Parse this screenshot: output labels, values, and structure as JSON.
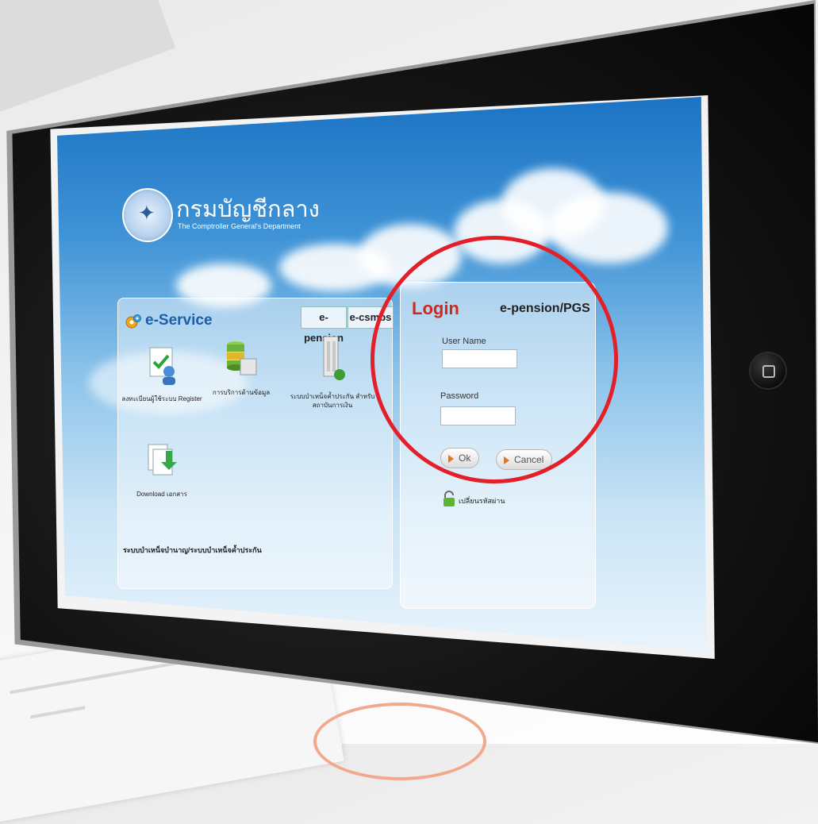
{
  "logo": {
    "thai_name": "กรมบัญชีกลาง",
    "english_name": "The Comptroller General's Department"
  },
  "eservice": {
    "title": "e-Service",
    "tabs": [
      "e-pension",
      "e-csmbs"
    ],
    "items": [
      {
        "label": "ลงทะเบียนผู้ใช้ระบบ Register",
        "icon": "register-icon"
      },
      {
        "label": "การบริการด้านข้อมูล",
        "icon": "database-icon"
      },
      {
        "label": "ระบบบำเหน็จค้ำประกัน สำหรับสถาบันการเงิน",
        "icon": "building-icon"
      },
      {
        "label": "Download เอกสาร",
        "icon": "download-icon"
      }
    ],
    "footer": "ระบบบำเหน็จบำนาญ/ระบบบำเหน็จค้ำประกัน"
  },
  "login": {
    "title": "Login",
    "system": "e-pension/PGS",
    "username_label": "User Name",
    "username_value": "",
    "password_label": "Password",
    "password_value": "",
    "ok_label": "Ok",
    "cancel_label": "Cancel",
    "change_password": "เปลี่ยนรหัสผ่าน"
  },
  "colors": {
    "highlight_ring": "#e3202a",
    "login_title": "#d0281e",
    "eservice_title": "#1c5ea8"
  }
}
